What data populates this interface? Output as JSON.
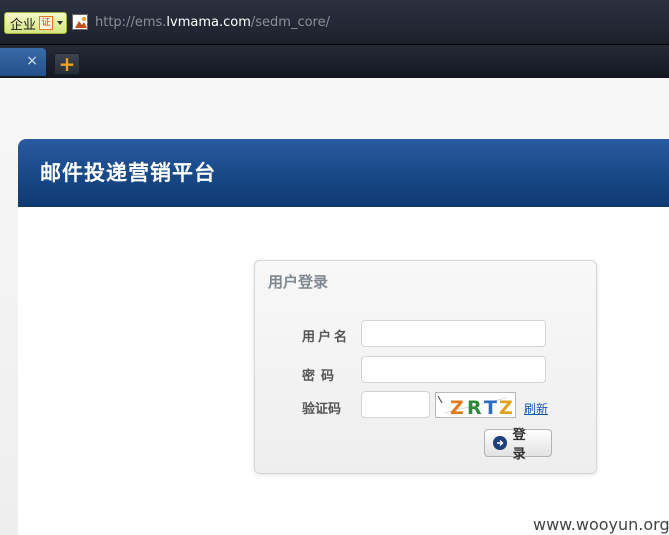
{
  "browser": {
    "badge_label": "企业",
    "badge_seal": "证",
    "url_prefix": "http://ems.",
    "url_host": "lvmama.com",
    "url_path": "/sedm_core/",
    "tab_close": "×",
    "new_tab": "+"
  },
  "page": {
    "banner_title": "邮件投递营销平台"
  },
  "login": {
    "title": "用户登录",
    "username_label": "用户名",
    "username_value": "",
    "password_label": "密码",
    "password_value": "",
    "captcha_label": "验证码",
    "captcha_value": "",
    "captcha_text": "ZRTZ",
    "refresh_label": "刷新",
    "submit_label": "登 录"
  },
  "watermark": "www.wooyun.org",
  "colors": {
    "banner": "#174684",
    "link": "#1a56b0",
    "captcha_z1": "#e07a20",
    "captcha_r": "#2a8a3a",
    "captcha_t": "#2a6ac0",
    "captcha_z2": "#e0a020"
  }
}
